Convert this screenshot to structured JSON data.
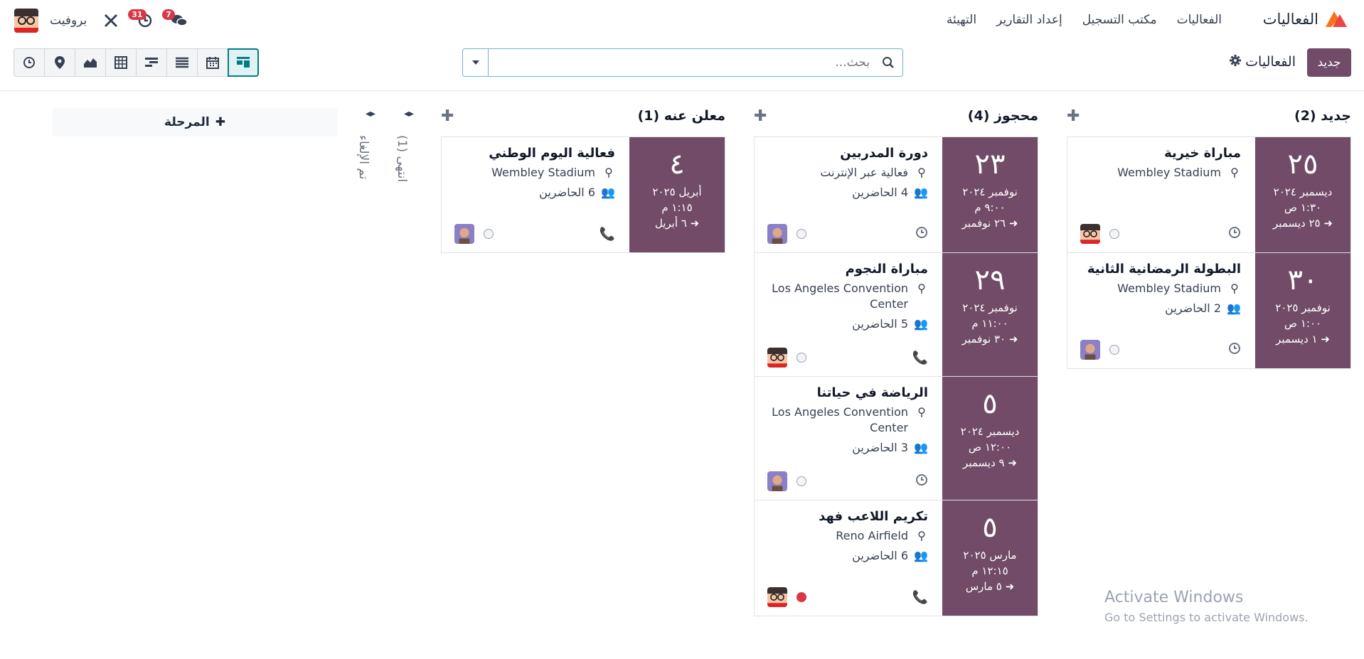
{
  "app": {
    "name": "الفعاليات",
    "menu": [
      "الفعاليات",
      "مكتب التسجيل",
      "إعداد التقارير",
      "التهيئة"
    ]
  },
  "systray": {
    "company": "بروفيت",
    "messages_count": "7",
    "activities_count": "31"
  },
  "control": {
    "new_label": "جديد",
    "breadcrumb": "الفعاليات",
    "search_placeholder": "بحث..."
  },
  "columns": [
    {
      "title": "جديد (2)",
      "cards": [
        {
          "day": "٢٥",
          "month": "ديسمبر ٢٠٢٤",
          "time": "١:٣٠ ص",
          "end": "٢٥ ديسمبر",
          "title": "مباراة خيرية",
          "location": "Wembley Stadium",
          "attendees": "",
          "activity": "clock-icon",
          "status": "normal"
        },
        {
          "day": "٣٠",
          "month": "نوفمبر ٢٠٢٥",
          "time": "١:٠٠ ص",
          "end": "١ ديسمبر",
          "title": "البطولة الرمضانية الثانية",
          "location": "Wembley Stadium",
          "attendees": "2 الحاضرين",
          "activity": "clock-icon",
          "status": "normal"
        }
      ]
    },
    {
      "title": "محجوز (4)",
      "cards": [
        {
          "day": "٢٣",
          "month": "نوفمبر ٢٠٢٤",
          "time": "٩:٠٠ م",
          "end": "٢٦ نوفمبر",
          "title": "دورة المدربين",
          "location": "فعالية عبر الإنترنت",
          "attendees": "4 الحاضرين",
          "activity": "clock-icon",
          "status": "normal"
        },
        {
          "day": "٢٩",
          "month": "نوفمبر ٢٠٢٤",
          "time": "١١:٠٠ م",
          "end": "٣٠ نوفمبر",
          "title": "مباراة النجوم",
          "location": "Los Angeles Convention Center",
          "attendees": "5 الحاضرين",
          "activity": "phone-green-icon",
          "status": "normal"
        },
        {
          "day": "٥",
          "month": "ديسمبر ٢٠٢٤",
          "time": "١٢:٠٠ ص",
          "end": "٩ ديسمبر",
          "title": "الرياضة في حياتنا",
          "location": "Los Angeles Convention Center",
          "attendees": "3 الحاضرين",
          "activity": "clock-icon",
          "status": "normal"
        },
        {
          "day": "٥",
          "month": "مارس ٢٠٢٥",
          "time": "١٢:١٥ م",
          "end": "٥ مارس",
          "title": "تكريم اللاعب فهد",
          "location": "Reno Airfield",
          "attendees": "6 الحاضرين",
          "activity": "phone-orange-icon",
          "status": "blocked"
        }
      ]
    },
    {
      "title": "معلن عنه (1)",
      "cards": [
        {
          "day": "٤",
          "month": "أبريل ٢٠٢٥",
          "time": "١:١٥ م",
          "end": "٦ أبريل",
          "title": "فعالية اليوم الوطني",
          "location": "Wembley Stadium",
          "attendees": "6 الحاضرين",
          "activity": "phone-orange-icon",
          "status": "normal"
        }
      ]
    }
  ],
  "folded": [
    {
      "label": "انتهى (1)"
    },
    {
      "label": "تم الإلغاء"
    }
  ],
  "add_stage": "المرحلة",
  "watermark": {
    "line1": "Activate Windows",
    "line2": "Go to Settings to activate Windows."
  },
  "colors": {
    "primary": "#714b67",
    "accent": "#017e84"
  }
}
